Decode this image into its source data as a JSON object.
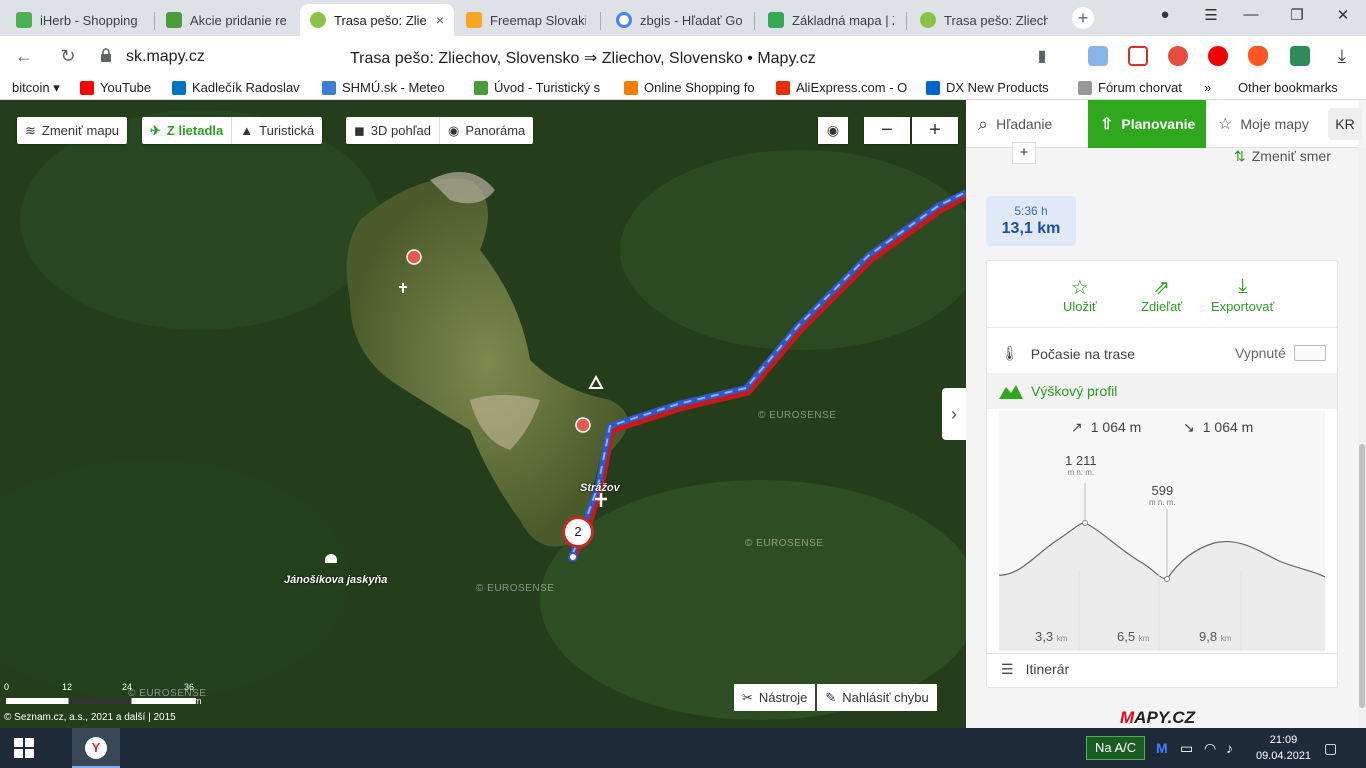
{
  "browser": {
    "tabs": [
      {
        "title": "iHerb - Shopping",
        "color": "#4caf50"
      },
      {
        "title": "Akcie pridanie rea",
        "color": "#4a9b3a"
      },
      {
        "title": "Trasa pešo: Zlie",
        "color": "#8bc34a",
        "active": true
      },
      {
        "title": "Freemap Slovakia",
        "color": "#f5a623"
      },
      {
        "title": "zbgis - Hľadať Go",
        "color": "#4285f4"
      },
      {
        "title": "Základná mapa | Z",
        "color": "#34a853"
      },
      {
        "title": "Trasa pešo: Zliech",
        "color": "#8bc34a"
      }
    ],
    "tab_close": "×",
    "new_tab": "+",
    "url": "sk.mapy.cz",
    "page_title": "Trasa pešo: Zliechov, Slovensko ⇒ Zliechov, Slovensko • Mapy.cz",
    "bookmarks": [
      {
        "label": "bitcoin ▾",
        "color": ""
      },
      {
        "label": "YouTube",
        "color": "#ff0000"
      },
      {
        "label": "Kadlečík Radoslav",
        "color": "#0072c6"
      },
      {
        "label": "SHMÚ.sk - Meteo",
        "color": "#3b7dd8"
      },
      {
        "label": "Úvod - Turistický s",
        "color": "#4a9b3a"
      },
      {
        "label": "Online Shopping fo",
        "color": "#f57c00"
      },
      {
        "label": "AliExpress.com - O",
        "color": "#e62e04"
      },
      {
        "label": "DX New Products",
        "color": "#0066cc"
      },
      {
        "label": "Fórum chorvat",
        "color": "#999999"
      }
    ],
    "more_bookmarks": "»",
    "other_bookmarks": "Other bookmarks"
  },
  "map": {
    "change_map": "Zmeniť mapu",
    "aerial": "Z lietadla",
    "tourist": "Turistická",
    "view3d": "3D pohľad",
    "panorama": "Panoráma",
    "zoom_out": "−",
    "zoom_in": "+",
    "waypoint_number": "2",
    "label_village": "Strážov",
    "label_cave": "Jánošíkova jaskyňa",
    "watermark": "© EUROSENSE",
    "tools": "Nástroje",
    "report": "Nahlásiť chybu",
    "scale_ticks": [
      "0",
      "12",
      "24",
      "36"
    ],
    "scale_unit": "m",
    "copyright": "© Seznam.cz, a.s., 2021 a další | 2015",
    "collapse": "›"
  },
  "panel": {
    "tab_search": "Hľadanie",
    "tab_planning": "Planovanie",
    "tab_my_maps": "Moje mapy",
    "avatar": "KR",
    "add_point": "+",
    "change_direction": "Zmeniť smer",
    "duration": "5:36 h",
    "distance": "13,1 km",
    "save": "Uložiť",
    "share": "Zdieľať",
    "export": "Exportovať",
    "weather": "Počasie na trase",
    "weather_state": "Vypnuté",
    "elevation_profile": "Výškový profil",
    "ascent": "1 064 m",
    "descent": "1 064 m",
    "peak_max": "1 211",
    "peak_min": "599",
    "peak_unit": "m n. m.",
    "km_ticks": [
      "3,3",
      "6,5",
      "9,8"
    ],
    "km_unit": "km",
    "itinerary": "Itinerár",
    "logo_m": "M",
    "logo_rest": "APY.CZ"
  },
  "taskbar": {
    "nac": "Na A/C",
    "time": "21:09",
    "date": "09.04.2021"
  }
}
